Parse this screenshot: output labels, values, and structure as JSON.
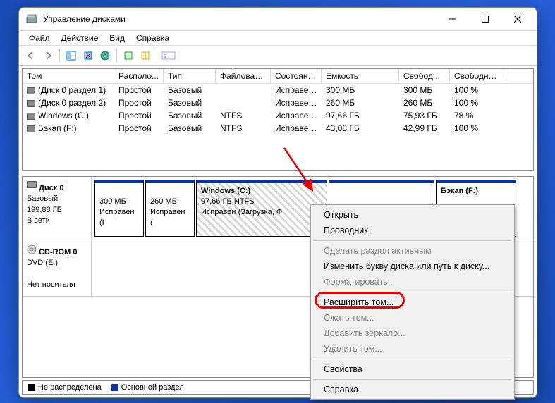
{
  "window": {
    "title": "Управление дисками"
  },
  "menu": {
    "file": "Файл",
    "action": "Действие",
    "view": "Вид",
    "help": "Справка"
  },
  "columns": {
    "volume": "Том",
    "layout": "Располо...",
    "type": "Тип",
    "fs": "Файловая с...",
    "status": "Состояние",
    "capacity": "Емкость",
    "free": "Свобод...",
    "pct": "Свободно %"
  },
  "volumes": [
    {
      "name": "(Диск 0 раздел 1)",
      "layout": "Простой",
      "type": "Базовый",
      "fs": "",
      "status": "Исправен...",
      "capacity": "300 МБ",
      "free": "300 МБ",
      "pct": "100 %"
    },
    {
      "name": "(Диск 0 раздел 2)",
      "layout": "Простой",
      "type": "Базовый",
      "fs": "",
      "status": "Исправен...",
      "capacity": "260 МБ",
      "free": "260 МБ",
      "pct": "100 %"
    },
    {
      "name": "Windows (C:)",
      "layout": "Простой",
      "type": "Базовый",
      "fs": "NTFS",
      "status": "Исправен...",
      "capacity": "97,66 ГБ",
      "free": "75,93 ГБ",
      "pct": "78 %"
    },
    {
      "name": "Бэкап (F:)",
      "layout": "Простой",
      "type": "Базовый",
      "fs": "NTFS",
      "status": "Исправен...",
      "capacity": "43,08 ГБ",
      "free": "42,99 ГБ",
      "pct": "100 %"
    }
  ],
  "disk0": {
    "name": "Диск 0",
    "type": "Базовый",
    "size": "199,88 ГБ",
    "status": "В сети",
    "p1": {
      "size": "300 МБ",
      "status": "Исправен (I"
    },
    "p2": {
      "size": "260 МБ",
      "status": "Исправен ("
    },
    "p3": {
      "title": "Windows  (C:)",
      "line2": "97,66 ГБ NTFS",
      "line3": "Исправен (Загрузка, Ф"
    },
    "p5": {
      "title": "Бэкап (F:)"
    }
  },
  "cdrom": {
    "name": "CD-ROM 0",
    "line2": "DVD (E:)",
    "status": "Нет носителя"
  },
  "legend": {
    "unalloc": "Не распределена",
    "primary": "Основной раздел"
  },
  "context": {
    "open": "Открыть",
    "explorer": "Проводник",
    "active": "Сделать раздел активным",
    "change_letter": "Изменить букву диска или путь к диску...",
    "format": "Форматировать...",
    "extend": "Расширить том...",
    "shrink": "Сжать том...",
    "mirror": "Добавить зеркало...",
    "delete": "Удалить том...",
    "properties": "Свойства",
    "help": "Справка"
  }
}
